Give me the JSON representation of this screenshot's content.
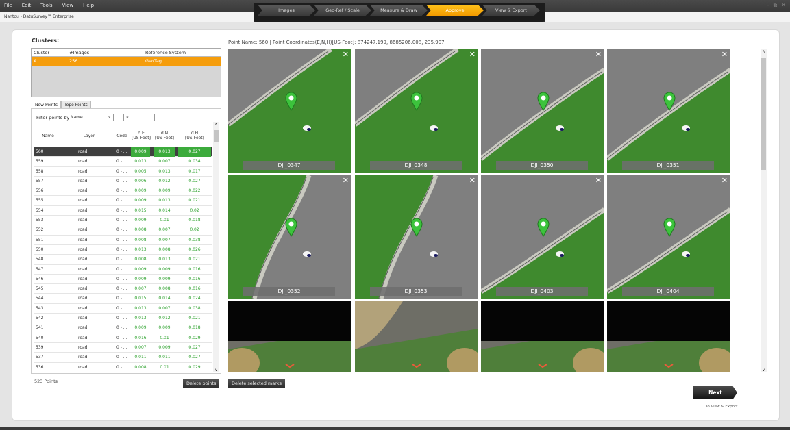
{
  "menu": [
    "File",
    "Edit",
    "Tools",
    "View",
    "Help"
  ],
  "app_title": "Nantou - DatuSurvey™ Enterprise",
  "window_controls": [
    "–",
    "⧉",
    "✕"
  ],
  "wizard": {
    "steps": [
      {
        "label": "Images",
        "active": false
      },
      {
        "label": "Geo-Ref / Scale",
        "active": false
      },
      {
        "label": "Measure & Draw",
        "active": false
      },
      {
        "label": "Approve",
        "active": true
      },
      {
        "label": "View & Export",
        "active": false
      }
    ]
  },
  "clusters": {
    "title": "Clusters:",
    "headers": [
      "Cluster",
      "#Images",
      "Reference System"
    ],
    "rows": [
      {
        "cluster": "A",
        "images": "256",
        "ref": "GeoTag"
      }
    ]
  },
  "tabs": [
    {
      "label": "New Points",
      "active": true
    },
    {
      "label": "Topo Points",
      "active": false
    }
  ],
  "filter": {
    "label": "Filter points by:",
    "value": "Name",
    "search_icon": "⌕"
  },
  "points_table": {
    "headers": {
      "name": "Name",
      "layer": "Layer",
      "code": "Code",
      "se": [
        "σ E",
        "[US-Foot]"
      ],
      "sn": [
        "σ N",
        "[US-Foot]"
      ],
      "sh": [
        "σ H",
        "[US-Foot]"
      ]
    },
    "rows": [
      {
        "name": "560",
        "layer": "road",
        "code": "0 - ...",
        "se": "0.009",
        "sn": "0.013",
        "sh": "0.027",
        "selected": true
      },
      {
        "name": "559",
        "layer": "road",
        "code": "0 - ...",
        "se": "0.013",
        "sn": "0.007",
        "sh": "0.034"
      },
      {
        "name": "558",
        "layer": "road",
        "code": "0 - ...",
        "se": "0.005",
        "sn": "0.013",
        "sh": "0.017"
      },
      {
        "name": "557",
        "layer": "road",
        "code": "0 - ...",
        "se": "0.006",
        "sn": "0.012",
        "sh": "0.027"
      },
      {
        "name": "556",
        "layer": "road",
        "code": "0 - ...",
        "se": "0.009",
        "sn": "0.009",
        "sh": "0.022"
      },
      {
        "name": "555",
        "layer": "road",
        "code": "0 - ...",
        "se": "0.009",
        "sn": "0.013",
        "sh": "0.021"
      },
      {
        "name": "554",
        "layer": "road",
        "code": "0 - ...",
        "se": "0.015",
        "sn": "0.014",
        "sh": "0.02"
      },
      {
        "name": "553",
        "layer": "road",
        "code": "0 - ...",
        "se": "0.009",
        "sn": "0.01",
        "sh": "0.018"
      },
      {
        "name": "552",
        "layer": "road",
        "code": "0 - ...",
        "se": "0.008",
        "sn": "0.007",
        "sh": "0.02"
      },
      {
        "name": "551",
        "layer": "road",
        "code": "0 - ...",
        "se": "0.008",
        "sn": "0.007",
        "sh": "0.038"
      },
      {
        "name": "550",
        "layer": "road",
        "code": "0 - ...",
        "se": "0.013",
        "sn": "0.008",
        "sh": "0.026"
      },
      {
        "name": "548",
        "layer": "road",
        "code": "0 - ...",
        "se": "0.008",
        "sn": "0.013",
        "sh": "0.021"
      },
      {
        "name": "547",
        "layer": "road",
        "code": "0 - ...",
        "se": "0.009",
        "sn": "0.009",
        "sh": "0.016"
      },
      {
        "name": "546",
        "layer": "road",
        "code": "0 - ...",
        "se": "0.009",
        "sn": "0.009",
        "sh": "0.016"
      },
      {
        "name": "545",
        "layer": "road",
        "code": "0 - ...",
        "se": "0.007",
        "sn": "0.008",
        "sh": "0.016"
      },
      {
        "name": "544",
        "layer": "road",
        "code": "0 - ...",
        "se": "0.015",
        "sn": "0.014",
        "sh": "0.024"
      },
      {
        "name": "543",
        "layer": "road",
        "code": "0 - ...",
        "se": "0.013",
        "sn": "0.007",
        "sh": "0.038"
      },
      {
        "name": "542",
        "layer": "road",
        "code": "0 - ...",
        "se": "0.013",
        "sn": "0.012",
        "sh": "0.021"
      },
      {
        "name": "541",
        "layer": "road",
        "code": "0 - ...",
        "se": "0.009",
        "sn": "0.009",
        "sh": "0.018"
      },
      {
        "name": "540",
        "layer": "road",
        "code": "0 - ...",
        "se": "0.016",
        "sn": "0.01",
        "sh": "0.029"
      },
      {
        "name": "539",
        "layer": "road",
        "code": "0 - ...",
        "se": "0.007",
        "sn": "0.009",
        "sh": "0.027"
      },
      {
        "name": "537",
        "layer": "road",
        "code": "0 - ...",
        "se": "0.011",
        "sn": "0.011",
        "sh": "0.027"
      },
      {
        "name": "536",
        "layer": "road",
        "code": "0 - ...",
        "se": "0.008",
        "sn": "0.01",
        "sh": "0.029"
      }
    ]
  },
  "points_count": "523 Points",
  "delete_points_label": "Delete points",
  "delete_marks_label": "Delete selected marks",
  "point_info": "Point Name: 560 | Point Coordinates(E,N,H)[US-Foot]: 874247.199, 8685206.008, 235.907",
  "images": [
    {
      "label": "DJI_0347",
      "variant": "a"
    },
    {
      "label": "DJI_0348",
      "variant": "a"
    },
    {
      "label": "DJI_0350",
      "variant": "b"
    },
    {
      "label": "DJI_0351",
      "variant": "b"
    },
    {
      "label": "DJI_0352",
      "variant": "c"
    },
    {
      "label": "DJI_0353",
      "variant": "c"
    },
    {
      "label": "DJI_0403",
      "variant": "d"
    },
    {
      "label": "DJI_0404",
      "variant": "d"
    }
  ],
  "partial_tiles": 4,
  "close_symbol": "✕",
  "next": {
    "label": "Next",
    "sub": "To View & Export"
  },
  "colors": {
    "accent": "#f59d0c",
    "pin": "#3cc33c",
    "selected_row": "#3f3f3f",
    "sigma_green": "#2aa02a"
  }
}
